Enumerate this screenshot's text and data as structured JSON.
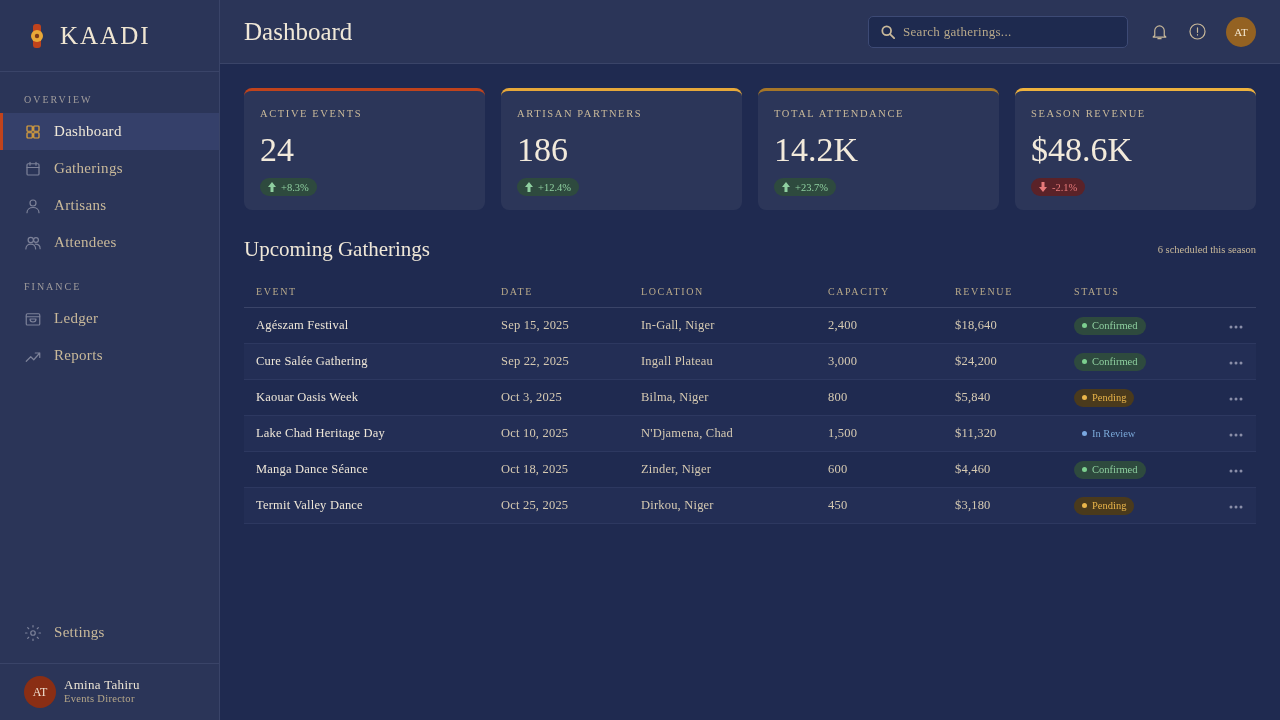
{
  "sidebar": {
    "brand": "KAADI",
    "sections": [
      {
        "title": "OVERVIEW",
        "items": [
          {
            "label": "Dashboard",
            "selected": true
          },
          {
            "label": "Gatherings",
            "selected": false
          },
          {
            "label": "Artisans",
            "selected": false
          },
          {
            "label": "Attendees",
            "selected": false
          }
        ]
      },
      {
        "title": "FINANCE",
        "items": [
          {
            "label": "Ledger",
            "selected": false
          },
          {
            "label": "Reports",
            "selected": false
          }
        ]
      }
    ],
    "bottom_items": [
      {
        "label": "Settings",
        "selected": false
      }
    ],
    "user": {
      "initials": "AT",
      "name": "Amina Tahiru",
      "role": "Events Director"
    }
  },
  "header": {
    "title": "Dashboard",
    "search": {
      "placeholder": "Search gatherings..."
    },
    "avatar": "AT"
  },
  "stats": [
    {
      "label": "ACTIVE EVENTS",
      "value": "24",
      "change": "+8.3%",
      "kind": "up",
      "color": "#c0431c"
    },
    {
      "label": "ARTISAN PARTNERS",
      "value": "186",
      "change": "+12.4%",
      "kind": "up",
      "color": "#e6a83a"
    },
    {
      "label": "TOTAL ATTENDANCE",
      "value": "14.2K",
      "change": "+23.7%",
      "kind": "up",
      "color": "#a67628"
    },
    {
      "label": "SEASON REVENUE",
      "value": "$48.6K",
      "change": "-2.1%",
      "kind": "down",
      "color": "#eeb23e"
    }
  ],
  "gatherings": {
    "title": "Upcoming Gatherings",
    "note": "6 scheduled this season",
    "table": {
      "columns": [
        "EVENT",
        "DATE",
        "LOCATION",
        "CAPACITY",
        "REVENUE",
        "STATUS"
      ],
      "rows": [
        {
          "event": "Agészam Festival",
          "date": "Sep 15, 2025",
          "location": "In-Gall, Niger",
          "capacity": "2,400",
          "revenue": "$18,640",
          "status": {
            "label": "Confirmed",
            "kind": "confirmed"
          }
        },
        {
          "event": "Cure Salée Gathering",
          "date": "Sep 22, 2025",
          "location": "Ingall Plateau",
          "capacity": "3,000",
          "revenue": "$24,200",
          "status": {
            "label": "Confirmed",
            "kind": "confirmed"
          }
        },
        {
          "event": "Kaouar Oasis Week",
          "date": "Oct 3, 2025",
          "location": "Bilma, Niger",
          "capacity": "800",
          "revenue": "$5,840",
          "status": {
            "label": "Pending",
            "kind": "pending"
          }
        },
        {
          "event": "Lake Chad Heritage Day",
          "date": "Oct 10, 2025",
          "location": "N'Djamena, Chad",
          "capacity": "1,500",
          "revenue": "$11,320",
          "status": {
            "label": "In Review",
            "kind": "review"
          }
        },
        {
          "event": "Manga Dance Séance",
          "date": "Oct 18, 2025",
          "location": "Zinder, Niger",
          "capacity": "600",
          "revenue": "$4,460",
          "status": {
            "label": "Confirmed",
            "kind": "confirmed"
          }
        },
        {
          "event": "Termit Valley Dance",
          "date": "Oct 25, 2025",
          "location": "Dirkou, Niger",
          "capacity": "450",
          "revenue": "$3,180",
          "status": {
            "label": "Pending",
            "kind": "pending"
          }
        }
      ]
    }
  }
}
